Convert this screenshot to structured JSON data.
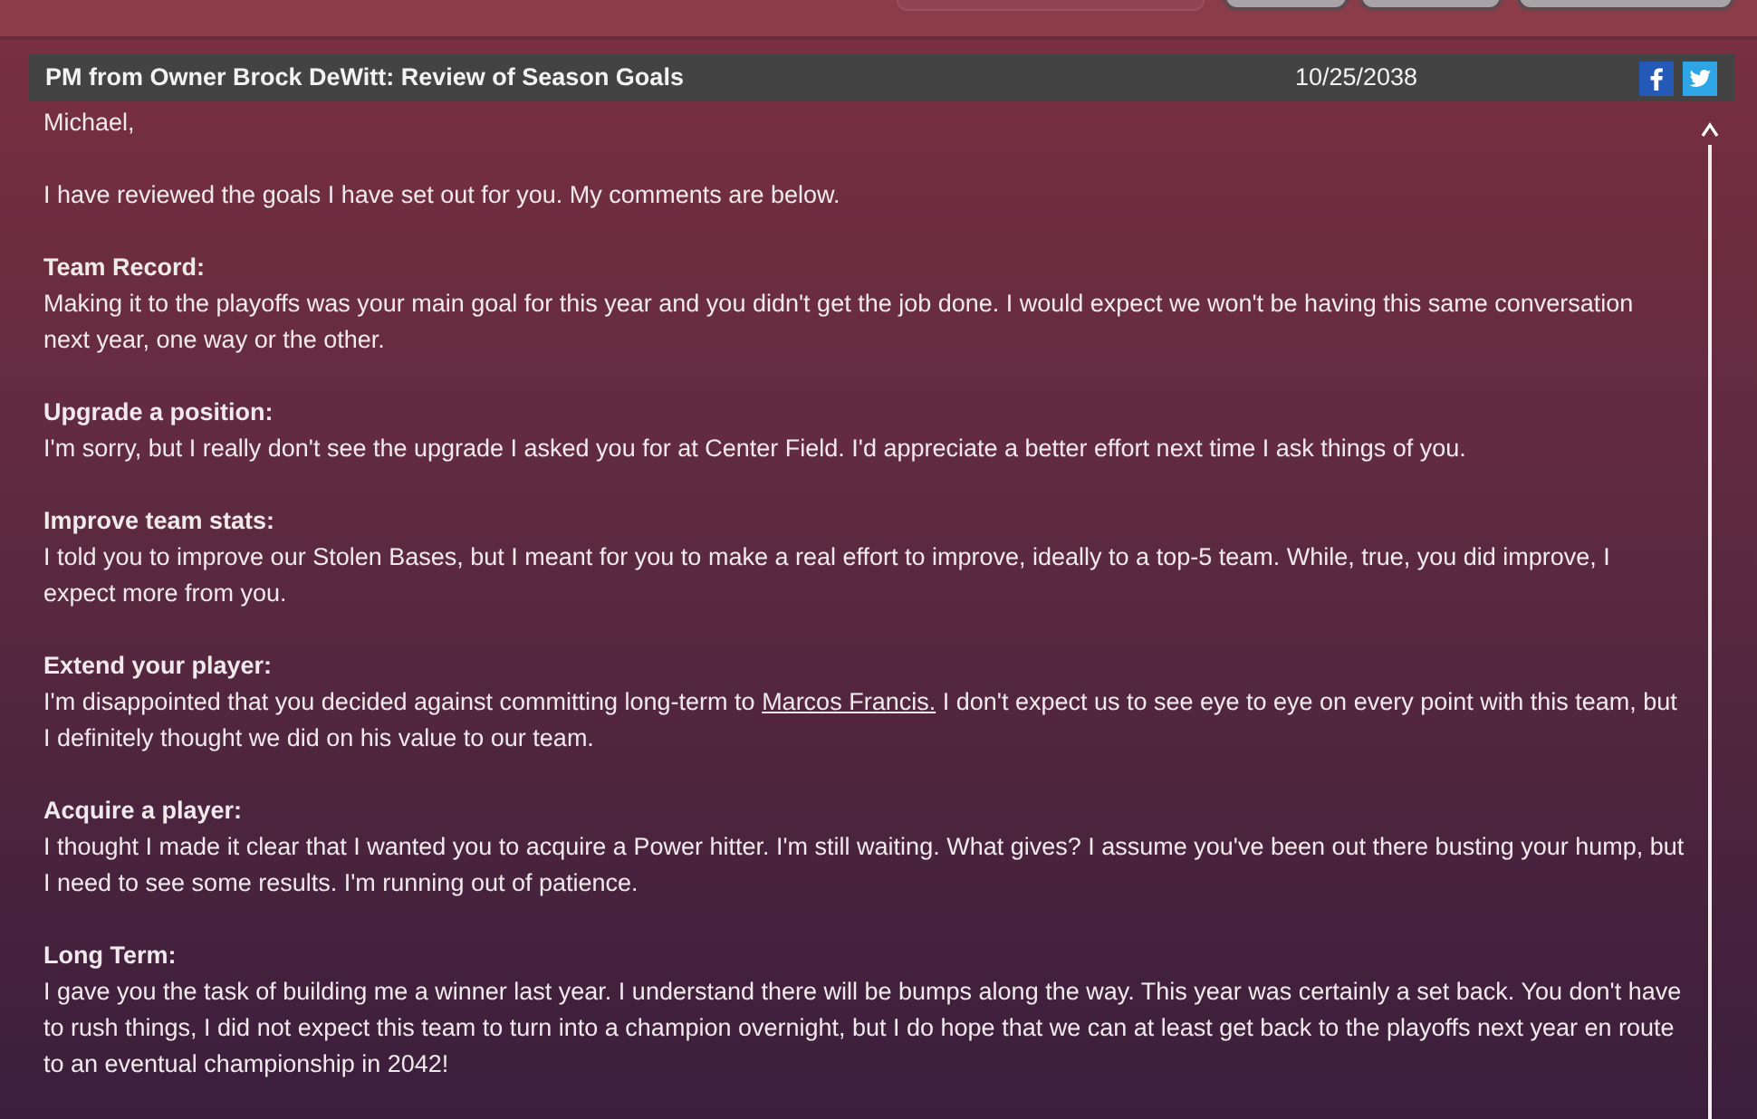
{
  "message": {
    "title": "PM from Owner Brock DeWitt: Review of Season Goals",
    "date": "10/25/2038",
    "greeting": "Michael,",
    "intro": "I have reviewed the goals I have set out for you.  My comments are below.",
    "sections": [
      {
        "heading": "Team Record:",
        "body": "Making it to the playoffs was your main goal for this year and you didn't get the job done. I would expect we won't be having this same conversation next year, one way or the other."
      },
      {
        "heading": "Upgrade a position:",
        "body": "I'm sorry, but I really don't see the upgrade I asked you for at Center Field. I'd appreciate a better effort next time I ask things of you."
      },
      {
        "heading": "Improve team stats:",
        "body": "I told you to improve our Stolen Bases, but I meant for you to make a real effort to improve, ideally to a top-5 team. While, true, you did improve, I expect more from you."
      },
      {
        "heading": "Extend your player:",
        "body": "I'm disappointed that you decided against committing long-term to",
        "link": "Marcos Francis.",
        "body_after": "I don't expect us to see eye to eye on every point with this team, but I definitely thought we did on his value to our team."
      },
      {
        "heading": "Acquire a player:",
        "body": "I thought I made it clear that I wanted you to acquire a Power hitter. I'm still waiting. What gives? I assume you've been out there busting your hump, but I need to see some results. I'm running out of patience."
      },
      {
        "heading": "Long Term:",
        "body": "I gave you the task of building me a winner last year. I understand there will be bumps along the way. This year was certainly a set back. You don't have to rush things, I did not expect this team to turn into a champion overnight, but I do hope that we can at least get back to the playoffs next year en route to an eventual championship in 2042!"
      }
    ]
  }
}
